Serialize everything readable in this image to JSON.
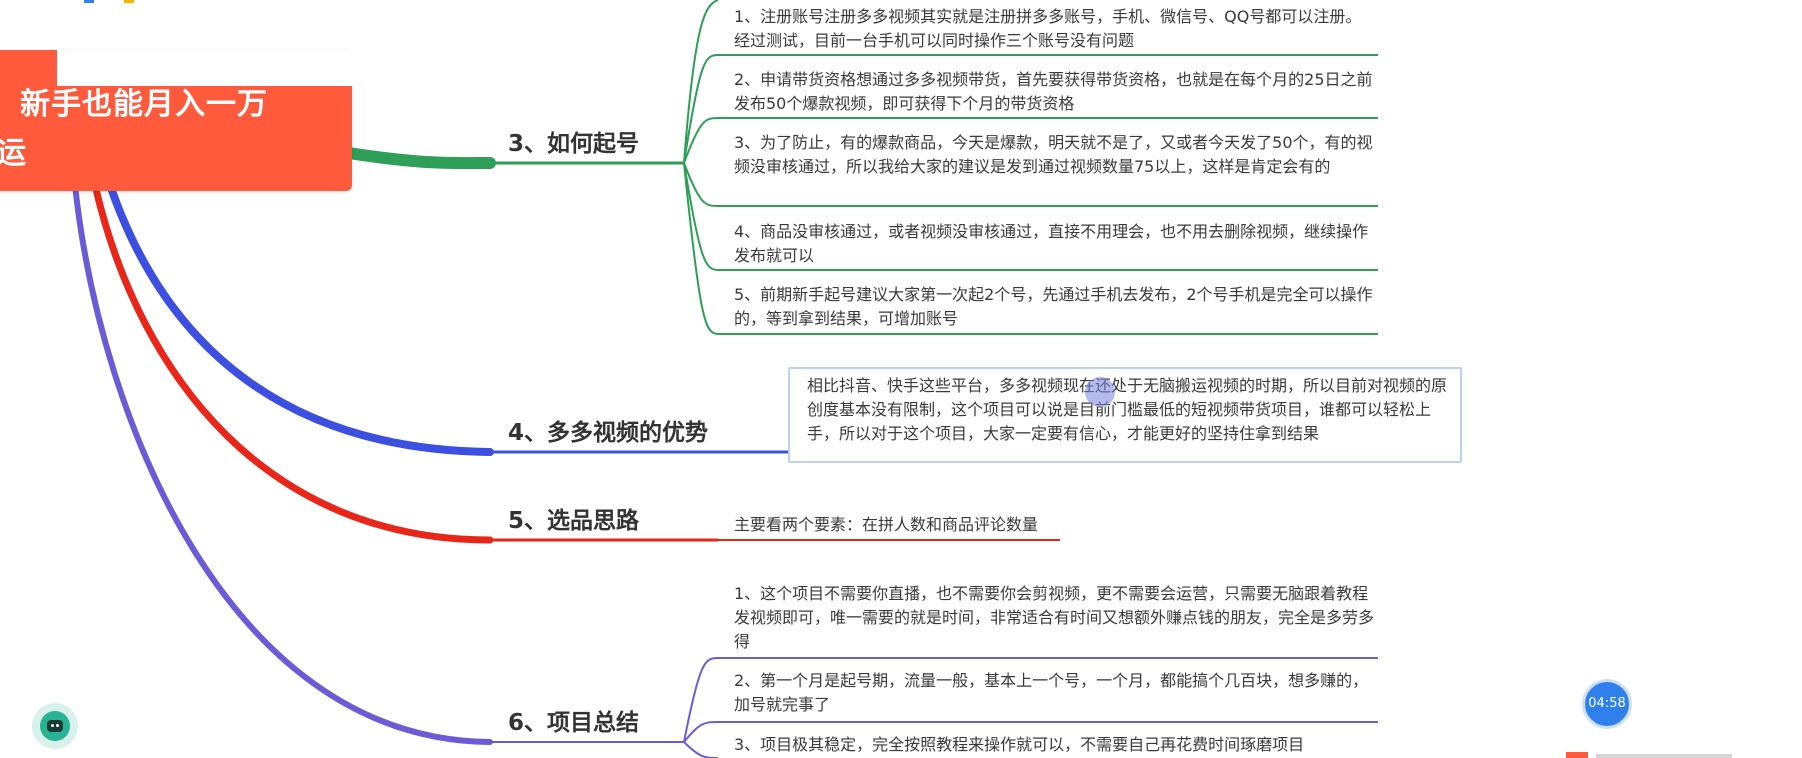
{
  "root": {
    "line1": "新手也能月入一万",
    "line2": "运"
  },
  "branches": [
    {
      "id": "b3",
      "title": "3、如何起号",
      "color": "#2e9e58",
      "leaves": [
        "1、注册账号注册多多视频其实就是注册拼多多账号，手机、微信号、QQ号都可以注册。经过测试，目前一台手机可以同时操作三个账号没有问题",
        "2、申请带货资格想通过多多视频带货，首先要获得带货资格，也就是在每个月的25日之前发布50个爆款视频，即可获得下个月的带货资格",
        "3、为了防止，有的爆款商品，今天是爆款，明天就不是了，又或者今天发了50个，有的视频没审核通过，所以我给大家的建议是发到通过视频数量75以上，这样是肯定会有的",
        "4、商品没审核通过，或者视频没审核通过，直接不用理会，也不用去删除视频，继续操作发布就可以",
        "5、前期新手起号建议大家第一次起2个号，先通过手机去发布，2个号手机是完全可以操作的，等到拿到结果，可增加账号"
      ]
    },
    {
      "id": "b4",
      "title": "4、多多视频的优势",
      "color": "#3d4fe0",
      "leaves": [
        "相比抖音、快手这些平台，多多视频现在还处于无脑搬运视频的时期，所以目前对视频的原创度基本没有限制，这个项目可以说是目前门槛最低的短视频带货项目，谁都可以轻松上手，所以对于这个项目，大家一定要有信心，才能更好的坚持住拿到结果"
      ]
    },
    {
      "id": "b5",
      "title": "5、选品思路",
      "color": "#e8261a",
      "leaves": [
        "主要看两个要素：在拼人数和商品评论数量"
      ]
    },
    {
      "id": "b6",
      "title": "6、项目总结",
      "color": "#6b5bd6",
      "leaves": [
        "1、这个项目不需要你直播，也不需要你会剪视频，更不需要会运营，只需要无脑跟着教程发视频即可，唯一需要的就是时间，非常适合有时间又想额外赚点钱的朋友，完全是多劳多得",
        "2、第一个月是起号期，流量一般，基本上一个号，一个月，都能搞个几百块，想多赚的，加号就完事了",
        "3、项目极其稳定，完全按照教程来操作就可以，不需要自己再花费时间琢磨项目"
      ]
    }
  ],
  "timer": "04:58",
  "icons": {
    "assistant": "robot-icon",
    "cursor": "cursor-dot"
  }
}
